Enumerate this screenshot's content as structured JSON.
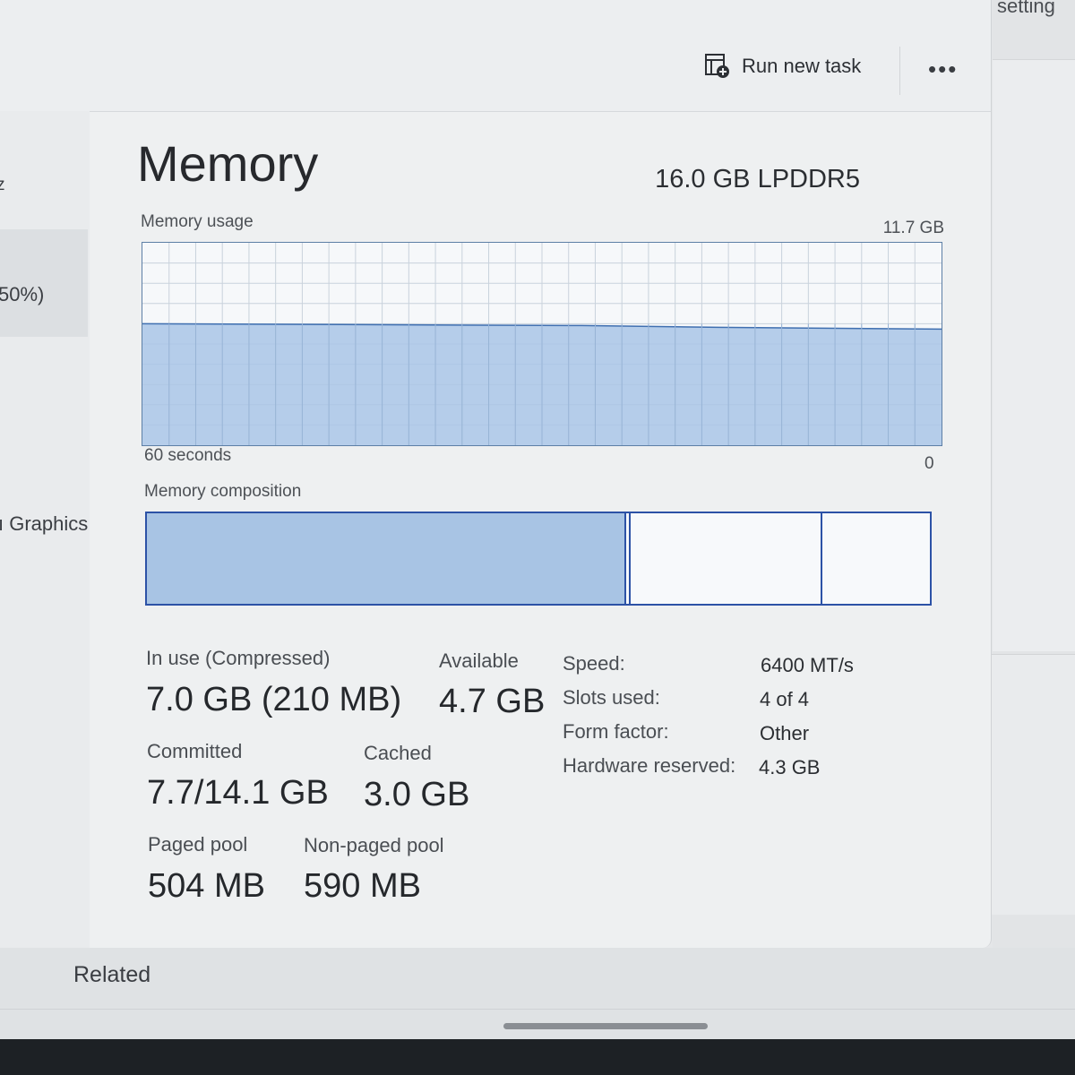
{
  "background": {
    "settings_text": "setting",
    "related_label": "Related"
  },
  "sidebar": {
    "item_z": "z",
    "item_percent": "50%)",
    "item_graphics": "Graphics"
  },
  "toolbar": {
    "run_new_task_label": "Run new task",
    "more_label": "•••"
  },
  "memory": {
    "title": "Memory",
    "spec": "16.0 GB LPDDR5",
    "usage_label": "Memory usage",
    "usage_max": "11.7 GB",
    "graph_time_label": "60 seconds",
    "graph_min_label": "0",
    "usage_level_fraction": 0.6,
    "composition_label": "Memory composition",
    "composition": {
      "in_use_fraction": 0.61,
      "modified_end_fraction": 0.615,
      "standby_end_fraction": 0.86
    },
    "stats": {
      "in_use_label": "In use (Compressed)",
      "in_use_value": "7.0 GB (210 MB)",
      "available_label": "Available",
      "available_value": "4.7 GB",
      "committed_label": "Committed",
      "committed_value": "7.7/14.1 GB",
      "cached_label": "Cached",
      "cached_value": "3.0 GB",
      "paged_pool_label": "Paged pool",
      "paged_pool_value": "504 MB",
      "non_paged_pool_label": "Non-paged pool",
      "non_paged_pool_value": "590 MB"
    },
    "details": {
      "speed_label": "Speed:",
      "speed_value": "6400 MT/s",
      "slots_label": "Slots used:",
      "slots_value": "4 of 4",
      "form_factor_label": "Form factor:",
      "form_factor_value": "Other",
      "hw_reserved_label": "Hardware reserved:",
      "hw_reserved_value": "4.3 GB"
    }
  },
  "colors": {
    "graph_fill": "#a9c5e6",
    "graph_line": "#3f6fb0",
    "accent_border": "#2c52a6"
  }
}
